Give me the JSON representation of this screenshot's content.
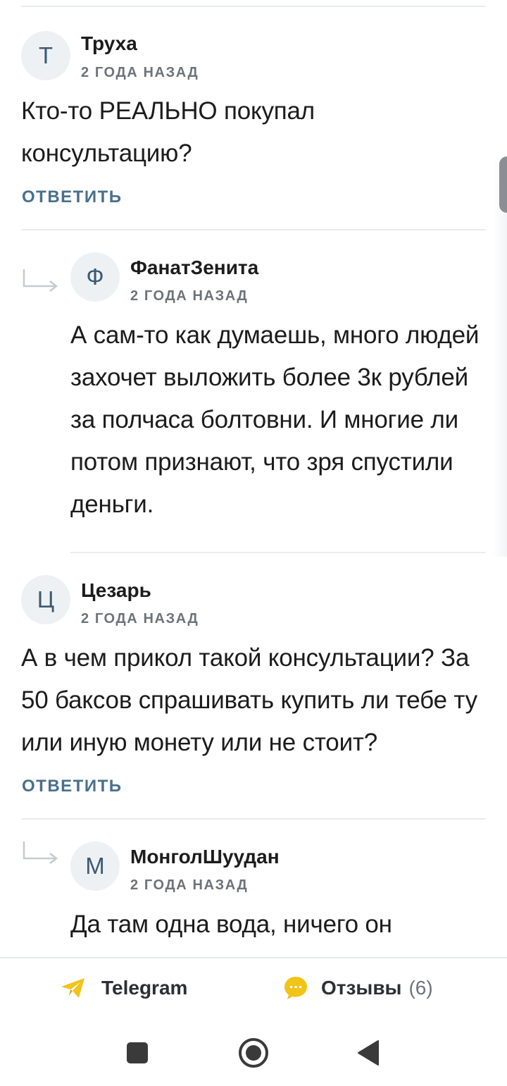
{
  "comments": [
    {
      "initial": "Т",
      "author": "Труха",
      "time": "2 ГОДА НАЗАД",
      "text": "Кто-то РЕАЛЬНО покупал консультацию?",
      "reply_label": "ОТВЕТИТЬ"
    },
    {
      "initial": "Ф",
      "author": "ФанатЗенита",
      "time": "2 ГОДА НАЗАД",
      "text": "А сам-то как думаешь, много людей захочет выложить более 3к рублей за полчаса болтовни. И многие ли потом признают, что зря спустили деньги."
    },
    {
      "initial": "Ц",
      "author": "Цезарь",
      "time": "2 ГОДА НАЗАД",
      "text": "А в чем прикол такой консультации? За 50 баксов спрашивать купить ли тебе ту или иную монету или не стоит?",
      "reply_label": "ОТВЕТИТЬ"
    },
    {
      "initial": "М",
      "author": "МонголШуудан",
      "time": "2 ГОДА НАЗАД",
      "text": "Да там одна вода, ничего он"
    }
  ],
  "bottom_bar": {
    "telegram_label": "Telegram",
    "reviews_label": "Отзывы",
    "reviews_count": "(6)"
  },
  "colors": {
    "accent": "#49708a",
    "telegram": "#f2c318",
    "reviews": "#f2c318"
  },
  "icons": {
    "telegram": "paper-plane-icon",
    "reviews": "chat-bubble-icon",
    "reply_arrow": "reply-arrow-icon",
    "nav_recent": "square-icon",
    "nav_home": "circle-icon",
    "nav_back": "triangle-back-icon"
  }
}
